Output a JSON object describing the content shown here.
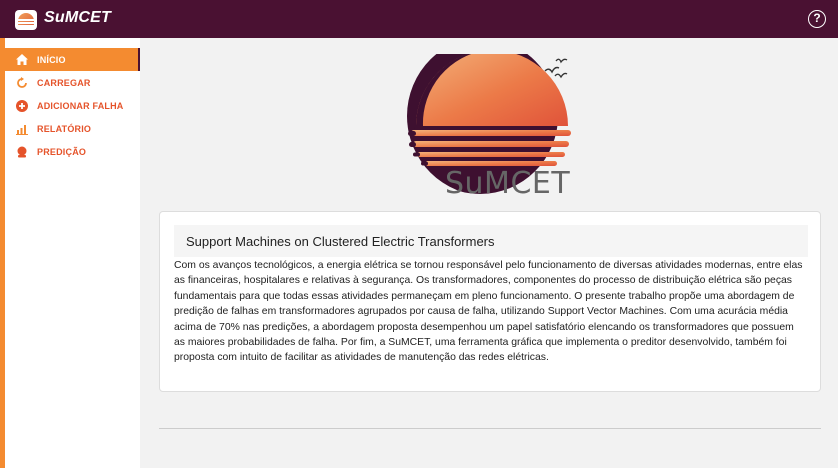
{
  "app": {
    "title": "SuMCET",
    "brand_color": "#4a1132",
    "accent_color": "#f48b30",
    "help_icon": "question-circle-icon",
    "help_label": "?"
  },
  "sidebar": {
    "items": [
      {
        "label": "INÍCIO",
        "icon": "home-icon",
        "active": true
      },
      {
        "label": "CARREGAR",
        "icon": "refresh-icon",
        "active": false
      },
      {
        "label": "ADICIONAR FALHA",
        "icon": "plus-circle-icon",
        "active": false
      },
      {
        "label": "RELATÓRIO",
        "icon": "bar-chart-icon",
        "active": false
      },
      {
        "label": "PREDIÇÃO",
        "icon": "crystal-ball-icon",
        "active": false
      }
    ]
  },
  "hero": {
    "logo_text": "SuMCET"
  },
  "card": {
    "title": "Support Machines on Clustered Electric Transformers",
    "body": "Com os avanços tecnológicos, a energia elétrica se tornou responsável pelo funcionamento de diversas atividades modernas, entre elas as financeiras, hospitalares e relativas à segurança. Os transformadores, componentes do processo de distribuição elétrica são peças fundamentais para que todas essas atividades permaneçam em pleno funcionamento. O presente trabalho propõe uma abordagem de predição de falhas em transformadores agrupados por causa de falha, utilizando Support Vector Machines. Com uma acurácia média acima de 70% nas predições, a abordagem proposta desempenhou um papel satisfatório elencando os transformadores que possuem as maiores probabilidades de falha. Por fim, a SuMCET, uma ferramenta gráfica que implementa o preditor desenvolvido, também foi proposta com intuito de facilitar as atividades de manutenção das redes elétricas."
  }
}
